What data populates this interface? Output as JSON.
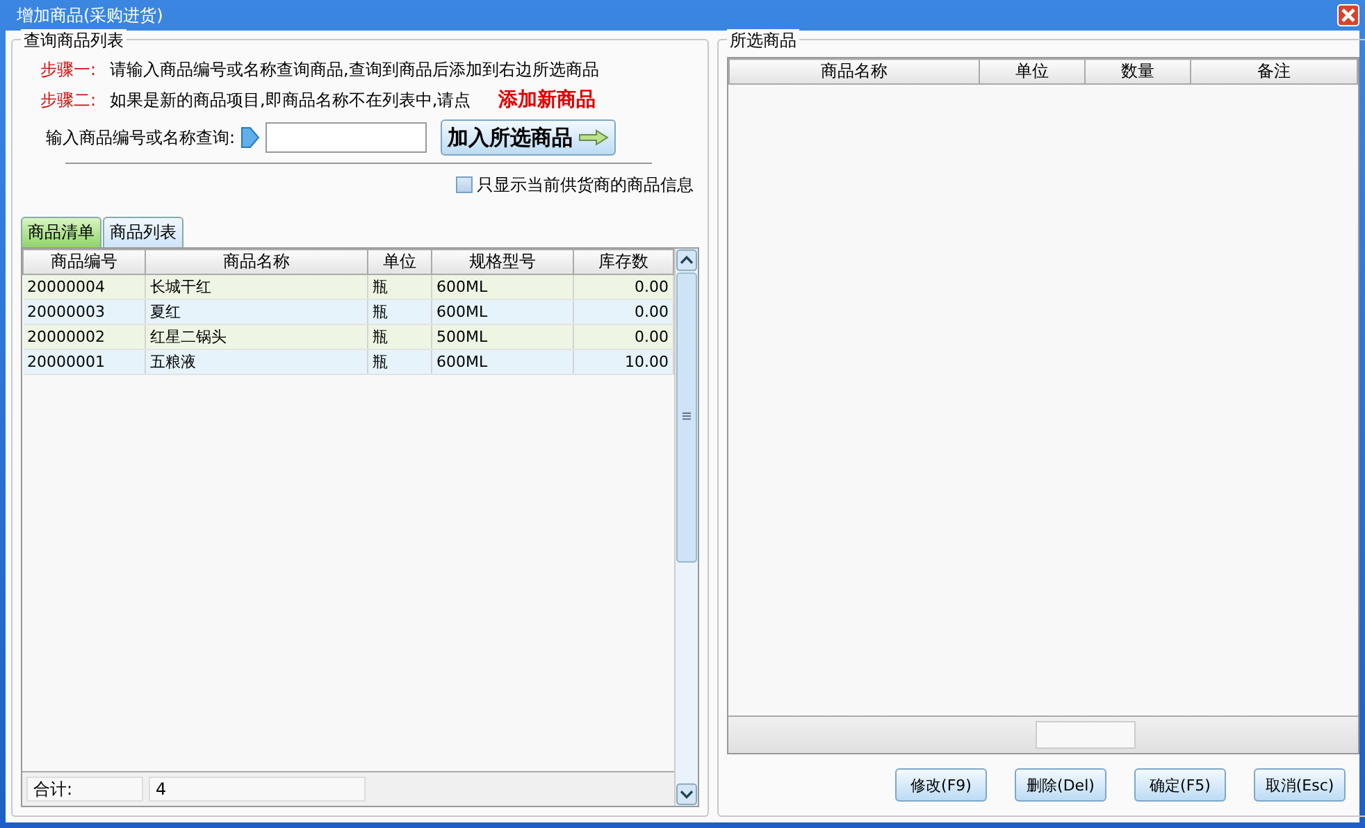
{
  "window": {
    "title": "增加商品(采购进货)"
  },
  "query_panel": {
    "title": "查询商品列表",
    "steps": [
      {
        "label": "步骤一:",
        "text": "请输入商品编号或名称查询商品,查询到商品后添加到右边所选商品"
      },
      {
        "label": "步骤二:",
        "text": "如果是新的商品项目,即商品名称不在列表中,请点",
        "link": "添加新商品"
      }
    ],
    "search_label": "输入商品编号或名称查询:",
    "add_button": "加入所选商品",
    "filter_checkbox": {
      "label": "只显示当前供货商的商品信息",
      "checked": false
    },
    "tabs": [
      {
        "label": "商品清单",
        "selected": true
      },
      {
        "label": "商品列表",
        "selected": false
      }
    ],
    "table": {
      "columns": [
        "商品编号",
        "商品名称",
        "单位",
        "规格型号",
        "库存数"
      ],
      "rows": [
        [
          "20000004",
          "长城干红",
          "瓶",
          "600ML",
          "0.00"
        ],
        [
          "20000003",
          "夏红",
          "瓶",
          "600ML",
          "0.00"
        ],
        [
          "20000002",
          "红星二锅头",
          "瓶",
          "500ML",
          "0.00"
        ],
        [
          "20000001",
          "五粮液",
          "瓶",
          "600ML",
          "10.00"
        ]
      ],
      "footer": {
        "label": "合计:",
        "value": "4"
      }
    }
  },
  "selected_panel": {
    "title": "所选商品",
    "table": {
      "columns": [
        "商品名称",
        "单位",
        "数量",
        "备注"
      ]
    },
    "buttons": [
      "修改(F9)",
      "删除(Del)",
      "确定(F5)",
      "取消(Esc)"
    ]
  }
}
